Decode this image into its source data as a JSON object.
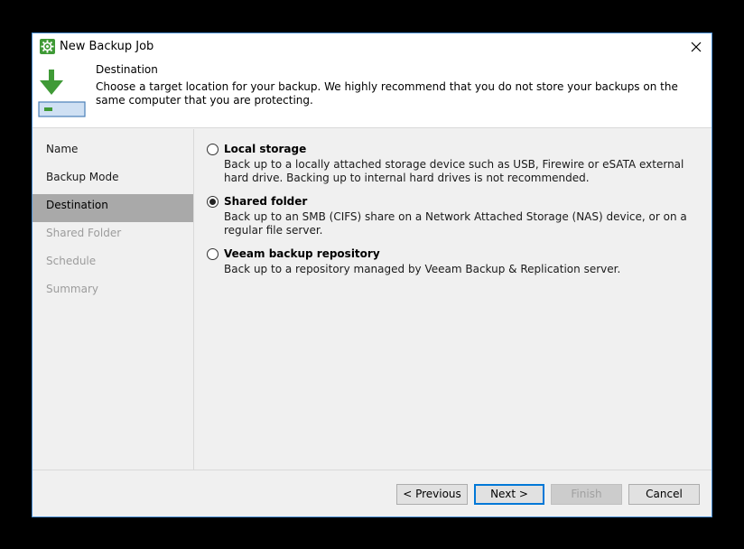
{
  "window": {
    "title": "New Backup Job",
    "accent_color": "#3f9a36"
  },
  "header": {
    "title": "Destination",
    "description": "Choose a target location for your backup. We highly recommend that you do not store your backups on the same computer that you are protecting."
  },
  "sidebar": {
    "items": [
      {
        "label": "Name",
        "state": "normal"
      },
      {
        "label": "Backup Mode",
        "state": "normal"
      },
      {
        "label": "Destination",
        "state": "active"
      },
      {
        "label": "Shared Folder",
        "state": "disabled"
      },
      {
        "label": "Schedule",
        "state": "disabled"
      },
      {
        "label": "Summary",
        "state": "disabled"
      }
    ]
  },
  "options": [
    {
      "title": "Local storage",
      "description": "Back up to a locally attached storage device such as USB, Firewire or eSATA external hard drive. Backing up to internal hard drives is not recommended.",
      "selected": false
    },
    {
      "title": "Shared folder",
      "description": "Back up to an SMB (CIFS) share on a Network Attached Storage (NAS) device, or on a regular file server.",
      "selected": true
    },
    {
      "title": "Veeam backup repository",
      "description": "Back up to a repository managed by Veeam Backup & Replication server.",
      "selected": false
    }
  ],
  "footer": {
    "previous_label": "< Previous",
    "next_label": "Next >",
    "finish_label": "Finish",
    "cancel_label": "Cancel"
  }
}
